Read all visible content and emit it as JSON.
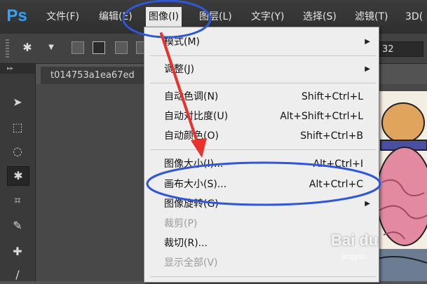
{
  "app": {
    "logo_text": "Ps"
  },
  "menubar": [
    {
      "label": "文件(F)"
    },
    {
      "label": "编辑(E)"
    },
    {
      "label": "图像(I)"
    },
    {
      "label": "图层(L)"
    },
    {
      "label": "文字(Y)"
    },
    {
      "label": "选择(S)"
    },
    {
      "label": "滤镜(T)"
    },
    {
      "label": "3D("
    }
  ],
  "options_bar": {
    "size_value": "32"
  },
  "document": {
    "tab_title": "t014753a1ea67ed"
  },
  "image_menu": [
    {
      "label": "模式(M)",
      "submenu": true
    },
    {
      "label": "调整(J)",
      "submenu": true
    },
    {
      "label": "自动色调(N)",
      "shortcut": "Shift+Ctrl+L"
    },
    {
      "label": "自动对比度(U)",
      "shortcut": "Alt+Shift+Ctrl+L"
    },
    {
      "label": "自动颜色(O)",
      "shortcut": "Shift+Ctrl+B"
    },
    {
      "label": "图像大小(I)...",
      "shortcut": "Alt+Ctrl+I"
    },
    {
      "label": "画布大小(S)...",
      "shortcut": "Alt+Ctrl+C"
    },
    {
      "label": "图像旋转(G)",
      "submenu": true
    },
    {
      "label": "裁剪(P)",
      "disabled": true
    },
    {
      "label": "裁切(R)..."
    },
    {
      "label": "显示全部(V)",
      "disabled": true
    }
  ],
  "watermark": {
    "text": "Bai du",
    "sub": "jingyan"
  },
  "colors": {
    "annotation_blue": "#2f57d6",
    "arrow_red": "#e8322b",
    "ps_blue": "#2fa3ff"
  }
}
